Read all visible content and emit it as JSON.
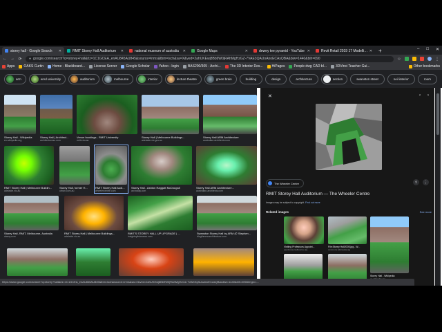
{
  "tabs": [
    {
      "title": "storey hall - Google Search",
      "color": "#4285f4",
      "active": true
    },
    {
      "title": "RMIT Storey Hall Auditorium",
      "color": "#00b0a0",
      "active": false
    },
    {
      "title": "national museum of australia",
      "color": "#e53935",
      "active": false
    },
    {
      "title": "Google Maps",
      "color": "#34a853",
      "active": false
    },
    {
      "title": "dewey tee pyramid - YouTube",
      "color": "#e53935",
      "active": false
    },
    {
      "title": "Revit Retail 2019 17 Modelling",
      "color": "#e53935",
      "active": false
    }
  ],
  "new_tab_label": "+",
  "window_controls": [
    "–",
    "□",
    "✕"
  ],
  "nav": {
    "back": "←",
    "forward": "→",
    "reload": "⟳"
  },
  "address_bar": {
    "url": "google.com/search?q=storey+hall&rlz=1C1GCEA_enAU845AU845&source=lnms&tbm=isch&sa=X&ved=2ahUKEwj8Bb9W0jRAhMgHzGZ-7VAE3QAUoAnoECAsQBA&biw=1440&bih=690"
  },
  "bookmarks": [
    {
      "label": "Apps"
    },
    {
      "label": "OAKS Curtin"
    },
    {
      "label": "Home - Blackboard..."
    },
    {
      "label": "License Server"
    },
    {
      "label": "Google Scholar"
    },
    {
      "label": "Yahoo - login"
    },
    {
      "label": "BAS200/305 - Archi..."
    },
    {
      "label": "The 3D Interior Des..."
    },
    {
      "label": "HiPages"
    },
    {
      "label": "People dwg CAD bl..."
    },
    {
      "label": "3DVinci Teacher Gui..."
    }
  ],
  "other_bookmarks": "Other bookmarks",
  "chips": [
    {
      "label": "arm",
      "color": "#2e7d32"
    },
    {
      "label": "ered university",
      "color": "#558b2f"
    },
    {
      "label": "auditorium",
      "color": "#6a4f2a"
    },
    {
      "label": "melbourne",
      "color": "#78909c"
    },
    {
      "label": "interior",
      "color": "#388e3c"
    },
    {
      "label": "lecture theatre",
      "color": "#8d6e63"
    },
    {
      "label": "green brain",
      "color": "#455a64"
    },
    {
      "label": "building",
      "color": ""
    },
    {
      "label": "design",
      "color": ""
    },
    {
      "label": "architecture",
      "color": ""
    },
    {
      "label": "section",
      "color": ""
    },
    {
      "label": "swanston street",
      "color": ""
    },
    {
      "label": "neil interior",
      "color": ""
    },
    {
      "label": "room",
      "color": ""
    }
  ],
  "results": [
    {
      "caption": "Storey Hall - Wikipedia",
      "source": "en.wikipedia.org"
    },
    {
      "caption": "Storey Hall | Architect...",
      "source": "architectureau.com"
    },
    {
      "caption": "Venue bookings - RMIT University",
      "source": "rmit.edu.au"
    },
    {
      "caption": "Storey Hall | Melbourne Buildings...",
      "source": "adelaide.vic.gov.au"
    },
    {
      "caption": "Storey Hall ARM Architecture",
      "source": "australian-architects.com"
    },
    {
      "caption": "RMIT Storey Hall | Melbourne Buildin...",
      "source": "adelaide.vic.au"
    },
    {
      "caption": "Storey Hall, former H...",
      "source": "urban.com.au"
    },
    {
      "caption": "RMIT Storey Hall Audi...",
      "source": "wheelercentre.com"
    },
    {
      "caption": "Storey Hall - Ashton Raggatt McDougall",
      "source": "archdaily.com"
    },
    {
      "caption": "Storey Hall ARM Architecture...",
      "source": "australian-architects.com"
    },
    {
      "caption": "Storey Hall, RMIT, Melbourne, Australia",
      "source": "alamy.com"
    },
    {
      "caption": "RMIT Storey Hall | Melbourne Buildings...",
      "source": "adelaide.vic.au"
    },
    {
      "caption": "RMIT'S STOREY HALL UP UPGRADE | ...",
      "source": "insightsylistanews.com"
    },
    {
      "caption": "Swanston Storey Hall by ARM (© Stephen...",
      "source": "blogthmmcarchitecture.com"
    }
  ],
  "preview": {
    "close": "✕",
    "prev": "‹",
    "next": "›",
    "site_label": "The Wheeler Centre",
    "share_icon": "⇪",
    "more_icon": "⋮",
    "title": "RMIT Storey Hall Auditorium — The Wheeler Centre",
    "copyright": "Images may be subject to copyright.",
    "learn_more": "Find out more",
    "related_heading": "Related images",
    "see_more": "See more",
    "related": [
      {
        "caption": "Visiting Professors Appoint...",
        "source": "openhousemelbourne.org"
      },
      {
        "caption": "File:Storey Hall2005.jpg - W...",
        "source": "commons.wikimedia.org"
      },
      {
        "caption": "",
        "source": ""
      },
      {
        "caption": "",
        "source": ""
      },
      {
        "caption": "",
        "source": ""
      },
      {
        "caption": "Storey Hall - Wikipedia",
        "source": "en.wikipedia.org"
      }
    ]
  },
  "status_url": "https://www.google.com/search?q=storey+hall&rlz=1C1GCEA_enAU845AU845&tbm=isch&source=lnms&sa=X&ved=2ahUKEwj8Bb9W0jRAhMgHzGZ-7VAE3QAUoAnoECAsQBA&biw=1440&bih=690#imgrc=..."
}
